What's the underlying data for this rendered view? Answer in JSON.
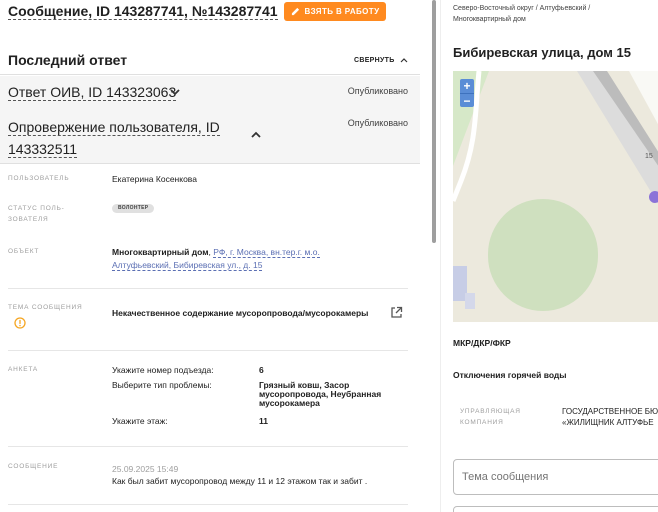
{
  "header": {
    "message_title": "Сообщение, ID 143287741, №143287741",
    "take_button": "ВЗЯТЬ В РАБОТУ"
  },
  "last_answer": {
    "title": "Последний ответ",
    "collapse": "СВЕРНУТЬ"
  },
  "oiv_answer": {
    "title": "Ответ ОИВ, ID 143323063",
    "status": "Опубликовано"
  },
  "refutation": {
    "title": "Опровержение пользователя, ID 143332511",
    "status": "Опубликовано"
  },
  "fields": {
    "user_label": "ПОЛЬЗОВАТЕЛЬ",
    "user_value": "Екатерина Косенкова",
    "status_label_line1": "СТАТУС ПОЛЬ-",
    "status_label_line2": "ЗОВАТЕЛЯ",
    "status_badge": "ВОЛОНТЕР",
    "object_label": "ОБЪЕКТ",
    "object_type": "Многоквартирный дом",
    "object_sep": ", ",
    "object_link_line1": "РФ, г. Москва, вн.тер.г. м.о.",
    "object_link_line2": "Алтуфьевский, Бибиревская ул., д. 15",
    "topic_label": "ТЕМА СООБЩЕНИЯ",
    "topic_value": "Некачественное содержание мусоропровода/мусорокамеры",
    "survey_label": "АНКЕТА",
    "message_label": "СООБЩЕНИЕ",
    "message_date": "25.09.2025 15:49",
    "message_text": "Как был забит мусоропровод между 11 и 12 этажом так и забит ."
  },
  "survey": [
    {
      "question": "Укажите номер подъезда:",
      "answer_lines": [
        "6"
      ]
    },
    {
      "question": "Выберите тип проблемы:",
      "answer_lines": [
        "Грязный ковш, Засор",
        "мусоропровода, Неубранная",
        "мусорокамера"
      ]
    },
    {
      "question": "Укажите этаж:",
      "answer_lines": [
        "11"
      ]
    }
  ],
  "right_panel": {
    "breadcrumb_line1": "Северо-Восточный округ / Алтуфьевский /",
    "breadcrumb_line2": "Многоквартирный дом",
    "address": "Бибиревская улица, дом 15",
    "map_zoom_in": "+",
    "map_zoom_out": "−",
    "map_label": "15",
    "mkr": "МКР/ДКР/ФКР",
    "hot_water": "Отключения горячей воды",
    "mgmt_label_line1": "УПРАВЛЯЮЩАЯ",
    "mgmt_label_line2": "КОМПАНИЯ",
    "mgmt_value_line1": "ГОСУДАРСТВЕННОЕ БЮ",
    "mgmt_value_line2": "«ЖИЛИЩНИК АЛТУФЬЕ",
    "topic_placeholder": "Тема сообщения"
  },
  "colors": {
    "accent_orange": "#ff8a1f",
    "link_blue": "#5b6fb3",
    "warning": "#f5a623",
    "map_zoom_blue": "#5a8dd6"
  }
}
